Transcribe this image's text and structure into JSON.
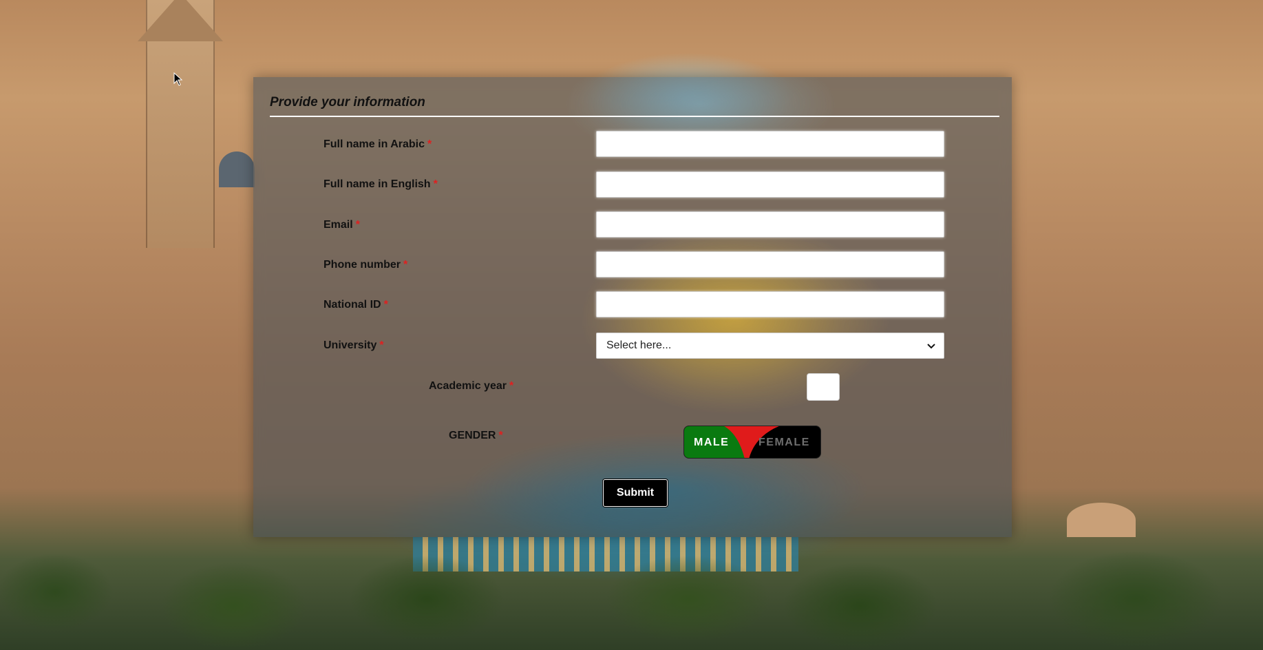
{
  "form": {
    "legend": "Provide your information",
    "required_mark": "*",
    "fields": [
      {
        "label": "Full name in Arabic",
        "value": ""
      },
      {
        "label": "Full name in English",
        "value": ""
      },
      {
        "label": "Email",
        "value": ""
      },
      {
        "label": "Phone number",
        "value": ""
      },
      {
        "label": "National ID",
        "value": ""
      }
    ],
    "university": {
      "label": "University",
      "selected": "Select here..."
    },
    "academic_year": {
      "label": "Academic year",
      "value": ""
    },
    "gender": {
      "label": "GENDER",
      "option_male": "MALE",
      "option_female": "FEMALE",
      "selected": "MALE"
    },
    "submit_label": "Submit"
  },
  "colors": {
    "toggle_male": "#0a7a10",
    "toggle_female": "#000000",
    "toggle_wedge": "#e01b1b",
    "required": "#e02020"
  },
  "icons": [
    "chevron-down-icon",
    "mouse-pointer-icon"
  ]
}
